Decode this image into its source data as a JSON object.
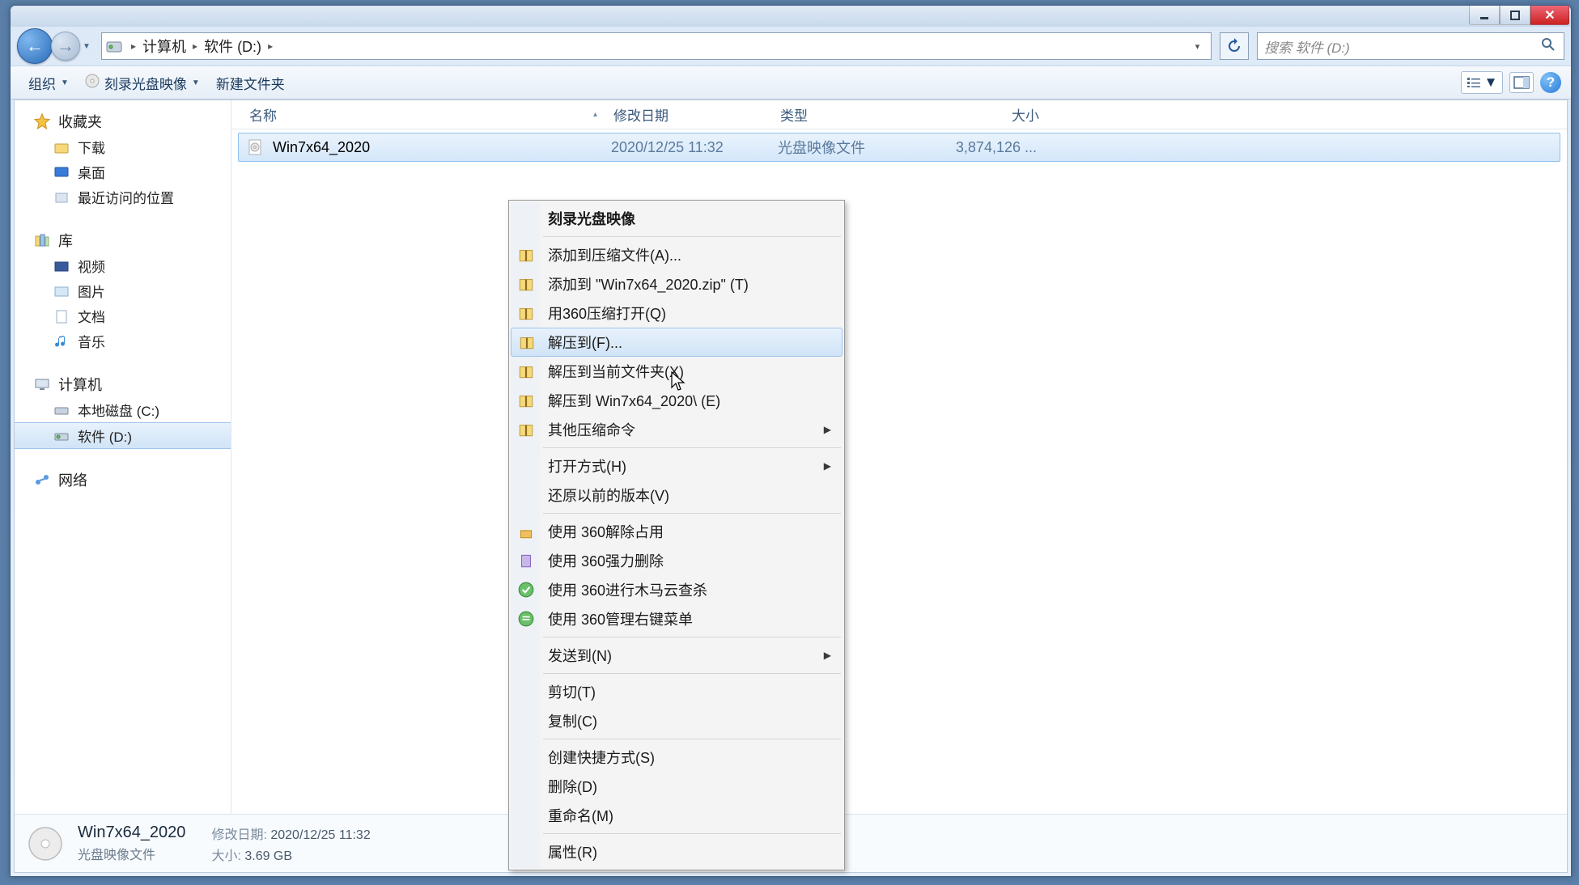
{
  "titlebar": {},
  "nav": {
    "breadcrumb": {
      "root": "计算机",
      "current": "软件 (D:)"
    },
    "search_placeholder": "搜索 软件 (D:)"
  },
  "toolbar": {
    "organize": "组织",
    "burn": "刻录光盘映像",
    "newfolder": "新建文件夹",
    "help": "?"
  },
  "sidebar": {
    "favorites": {
      "head": "收藏夹",
      "items": [
        "下载",
        "桌面",
        "最近访问的位置"
      ]
    },
    "libraries": {
      "head": "库",
      "items": [
        "视频",
        "图片",
        "文档",
        "音乐"
      ]
    },
    "computer": {
      "head": "计算机",
      "items": [
        "本地磁盘 (C:)",
        "软件 (D:)"
      ]
    },
    "network": {
      "head": "网络"
    }
  },
  "columns": {
    "name": "名称",
    "date": "修改日期",
    "type": "类型",
    "size": "大小"
  },
  "files": [
    {
      "name": "Win7x64_2020",
      "date": "2020/12/25 11:32",
      "type": "光盘映像文件",
      "size": "3,874,126 ..."
    }
  ],
  "details": {
    "title": "Win7x64_2020",
    "type": "光盘映像文件",
    "date_label": "修改日期:",
    "date": "2020/12/25 11:32",
    "size_label": "大小:",
    "size": "3.69 GB"
  },
  "context_menu": {
    "burn": "刻录光盘映像",
    "add_archive": "添加到压缩文件(A)...",
    "add_zip": "添加到 \"Win7x64_2020.zip\" (T)",
    "open_360zip": "用360压缩打开(Q)",
    "extract_to": "解压到(F)...",
    "extract_here": "解压到当前文件夹(X)",
    "extract_folder": "解压到 Win7x64_2020\\ (E)",
    "other_zip": "其他压缩命令",
    "open_with": "打开方式(H)",
    "restore_prev": "还原以前的版本(V)",
    "use_360_unlock": "使用 360解除占用",
    "use_360_force_del": "使用 360强力删除",
    "use_360_trojan": "使用 360进行木马云查杀",
    "use_360_ctxmenu": "使用 360管理右键菜单",
    "send_to": "发送到(N)",
    "cut": "剪切(T)",
    "copy": "复制(C)",
    "shortcut": "创建快捷方式(S)",
    "delete": "删除(D)",
    "rename": "重命名(M)",
    "properties": "属性(R)"
  }
}
